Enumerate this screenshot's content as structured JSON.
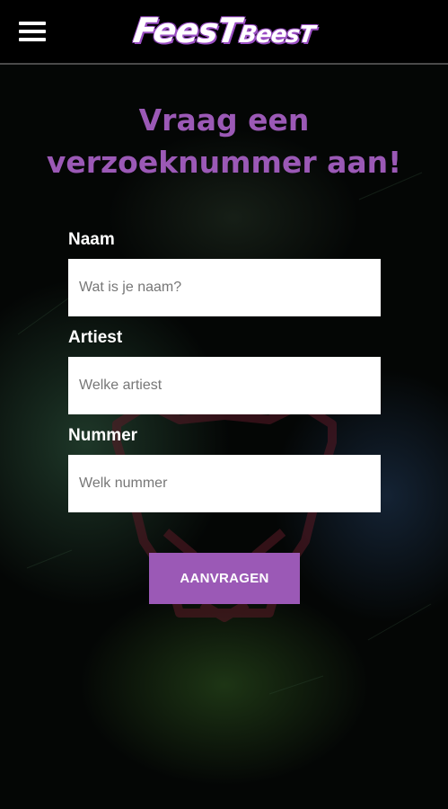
{
  "header": {
    "menu_icon": "hamburger-menu-icon",
    "logo": {
      "text_main": "FeesT",
      "text_small": "BeesT"
    }
  },
  "main": {
    "title": "Vraag een verzoeknummer aan!",
    "form": {
      "fields": [
        {
          "label": "Naam",
          "placeholder": "Wat is je naam?",
          "value": ""
        },
        {
          "label": "Artiest",
          "placeholder": "Welke artiest",
          "value": ""
        },
        {
          "label": "Nummer",
          "placeholder": "Welk nummer",
          "value": ""
        }
      ],
      "submit_label": "AANVRAGEN"
    }
  },
  "colors": {
    "accent": "#9b59b6",
    "background": "#000000",
    "input_background": "#ffffff"
  }
}
